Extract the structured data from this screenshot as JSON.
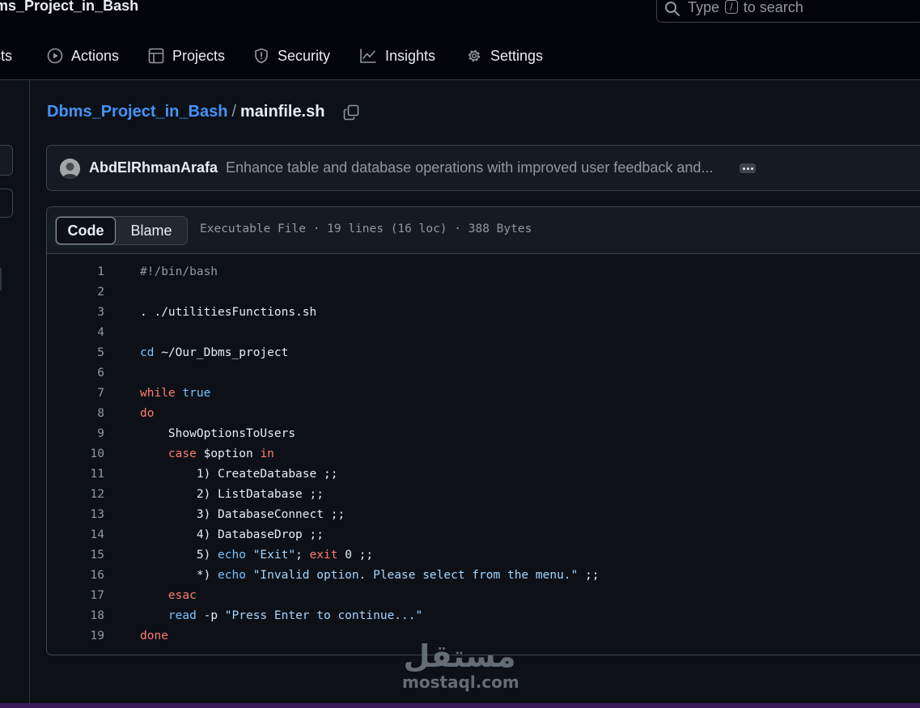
{
  "header": {
    "repo_title": "ms_Project_in_Bash",
    "search": {
      "before": "Type",
      "key": "/",
      "after": "to search"
    }
  },
  "nav": [
    {
      "label": "sts",
      "icon": "pull-request-icon"
    },
    {
      "label": "Actions",
      "icon": "play-circle-icon"
    },
    {
      "label": "Projects",
      "icon": "table-icon"
    },
    {
      "label": "Security",
      "icon": "shield-icon"
    },
    {
      "label": "Insights",
      "icon": "graph-icon"
    },
    {
      "label": "Settings",
      "icon": "gear-icon"
    }
  ],
  "breadcrumb": {
    "repo": "Dbms_Project_in_Bash",
    "separator": "/",
    "file": "mainfile.sh"
  },
  "commit": {
    "author": "AbdElRhmanArafa",
    "message": "Enhance table and database operations with improved user feedback and..."
  },
  "file_view": {
    "tab_code": "Code",
    "tab_blame": "Blame",
    "meta": "Executable File · 19 lines (16 loc) · 388 Bytes"
  },
  "code_lines": [
    "#!/bin/bash",
    "",
    ". ./utilitiesFunctions.sh",
    "",
    "cd ~/Our_Dbms_project",
    "",
    "while true",
    "do",
    "    ShowOptionsToUsers",
    "    case $option in",
    "        1) CreateDatabase ;;",
    "        2) ListDatabase ;;",
    "        3) DatabaseConnect ;;",
    "        4) DatabaseDrop ;;",
    "        5) echo \"Exit\"; exit 0 ;;",
    "        *) echo \"Invalid option. Please select from the menu.\" ;;",
    "    esac",
    "    read -p \"Press Enter to continue...\"",
    "done"
  ],
  "watermark": {
    "arabic": "مستقل",
    "latin": "mostaql.com"
  },
  "colors": {
    "background": "#0d1117",
    "link": "#4493f8",
    "keyword": "#ff7b72",
    "builtin": "#79c0ff",
    "string": "#a5d6ff"
  }
}
